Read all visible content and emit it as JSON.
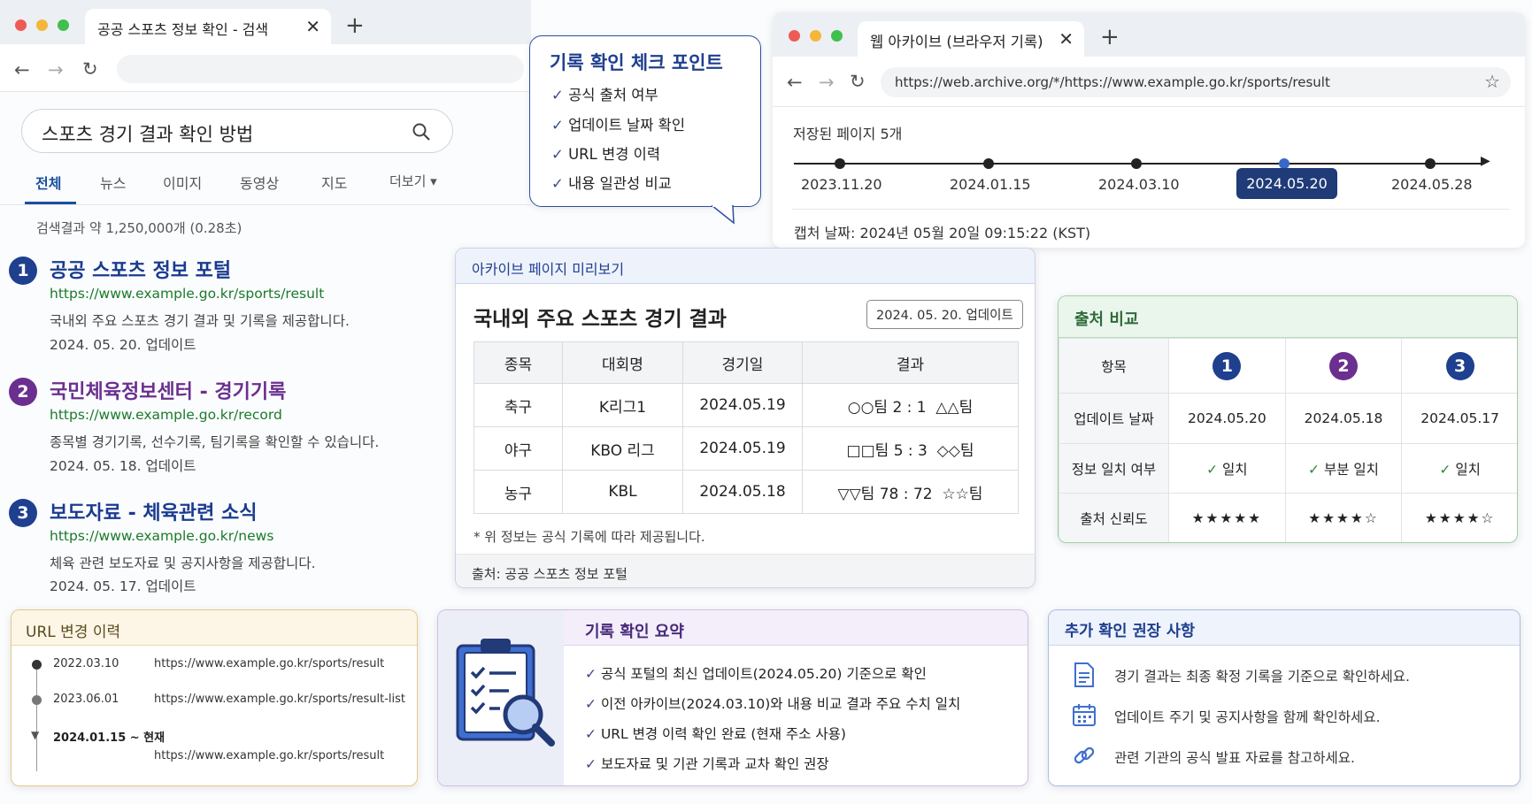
{
  "search_window": {
    "tab_title": "공공 스포츠 정보 확인 - 검색",
    "query": "스포츠 경기 결과 확인 방법",
    "tabs": [
      "전체",
      "뉴스",
      "이미지",
      "동영상",
      "지도",
      "더보기 ▾"
    ],
    "result_count": "검색결과 약 1,250,000개 (0.28초)",
    "results": [
      {
        "num": "1",
        "title": "공공 스포츠 정보 포털",
        "url": "https://www.example.go.kr/sports/result",
        "desc": "국내외 주요 스포츠 경기 결과 및 기록을 제공합니다.",
        "date": "2024. 05. 20. 업데이트",
        "color": "#1f3f8f"
      },
      {
        "num": "2",
        "title": "국민체육정보센터 - 경기기록",
        "url": "https://www.example.go.kr/record",
        "desc": "종목별 경기기록, 선수기록, 팀기록을 확인할 수 있습니다.",
        "date": "2024. 05. 18. 업데이트",
        "color": "#6b2f8f"
      },
      {
        "num": "3",
        "title": "보도자료 - 체육관련 소식",
        "url": "https://www.example.go.kr/news",
        "desc": "체육 관련 보도자료 및 공지사항을 제공합니다.",
        "date": "2024. 05. 17. 업데이트",
        "color": "#1f3f8f"
      }
    ]
  },
  "checkpoints": {
    "title": "기록 확인 체크 포인트",
    "items": [
      "공식 출처 여부",
      "업데이트 날짜 확인",
      "URL 변경 이력",
      "내용 일관성 비교"
    ]
  },
  "archive_window": {
    "tab_title": "웹 아카이브 (브라우저 기록)",
    "url": "https://web.archive.org/*/https://www.example.go.kr/sports/result",
    "saved_label": "저장된 페이지 5개",
    "dates": [
      "2023.11.20",
      "2024.01.15",
      "2024.03.10",
      "2024.05.20",
      "2024.05.28"
    ],
    "selected_date": "2024.05.20",
    "capture": "캡처 날짜: 2024년 05월 20일 09:15:22 (KST)"
  },
  "preview": {
    "header": "아카이브 페이지 미리보기",
    "title": "국내외 주요 스포츠 경기 결과",
    "badge": "2024. 05. 20. 업데이트",
    "columns": [
      "종목",
      "대회명",
      "경기일",
      "결과"
    ],
    "rows": [
      [
        "축구",
        "K리그1",
        "2024.05.19",
        "○○팀 2 : 1  △△팀"
      ],
      [
        "야구",
        "KBO 리그",
        "2024.05.19",
        "□□팀 5 : 3  ◇◇팀"
      ],
      [
        "농구",
        "KBL",
        "2024.05.18",
        "▽▽팀 78 : 72  ☆☆팀"
      ]
    ],
    "note": "* 위 정보는 공식 기록에 따라 제공됩니다.",
    "source": "출처: 공공 스포츠 정보 포털"
  },
  "compare": {
    "title": "출처 비교",
    "item_header": "항목",
    "sources": [
      {
        "num": "1",
        "color": "#1f3f8f"
      },
      {
        "num": "2",
        "color": "#6b2f8f"
      },
      {
        "num": "3",
        "color": "#1f3f8f"
      }
    ],
    "rows": [
      {
        "label": "업데이트 날짜",
        "vals": [
          "2024.05.20",
          "2024.05.18",
          "2024.05.17"
        ]
      },
      {
        "label": "정보 일치 여부",
        "vals": [
          "✓ 일치",
          "✓ 부분 일치",
          "✓ 일치"
        ]
      },
      {
        "label": "출처 신뢰도",
        "vals": [
          "★★★★★",
          "★★★★☆",
          "★★★★☆"
        ]
      }
    ]
  },
  "url_history": {
    "title": "URL 변경 이력",
    "entries": [
      {
        "date": "2022.03.10",
        "url": "https://www.example.go.kr/sports/result"
      },
      {
        "date": "2023.06.01",
        "url": "https://www.example.go.kr/sports/result-list"
      },
      {
        "date": "2024.01.15 ~ 현재",
        "url": "https://www.example.go.kr/sports/result"
      }
    ]
  },
  "summary": {
    "title": "기록 확인 요약",
    "items": [
      "공식 포털의 최신 업데이트(2024.05.20) 기준으로 확인",
      "이전 아카이브(2024.03.10)와 내용 비교 결과 주요 수치 일치",
      "URL 변경 이력 확인 완료 (현재 주소 사용)",
      "보도자료 및 기관 기록과 교차 확인 권장"
    ]
  },
  "recommend": {
    "title": "추가 확인 권장 사항",
    "items": [
      {
        "icon": "document-icon",
        "text": "경기 결과는 최종 확정 기록을 기준으로 확인하세요."
      },
      {
        "icon": "calendar-icon",
        "text": "업데이트 주기 및 공지사항을 함께 확인하세요."
      },
      {
        "icon": "link-icon",
        "text": "관련 기관의 공식 발표 자료를 참고하세요."
      }
    ]
  }
}
